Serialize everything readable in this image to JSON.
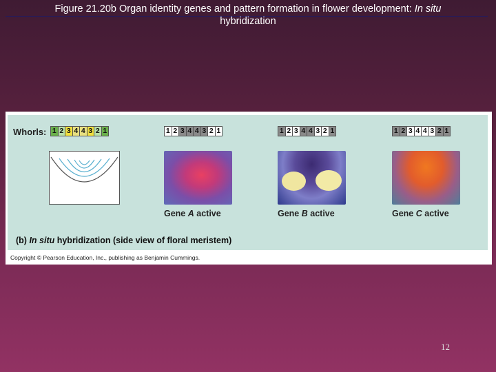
{
  "slide": {
    "title_main": "Figure 21.20b Organ identity genes and pattern formation in flower development: ",
    "title_italic": "In situ",
    "title_tail": "hybridization",
    "page_number": "12"
  },
  "figure": {
    "whorls_label": "Whorls:",
    "whorl_numbers": [
      "1",
      "2",
      "3",
      "4",
      "4",
      "3",
      "2",
      "1"
    ],
    "genes": [
      {
        "prefix": "Gene ",
        "letter": "A",
        "suffix": " active"
      },
      {
        "prefix": "Gene ",
        "letter": "B",
        "suffix": " active"
      },
      {
        "prefix": "Gene ",
        "letter": "C",
        "suffix": " active"
      }
    ],
    "caption_prefix": "(b) ",
    "caption_italic": "In situ",
    "caption_rest": " hybridization (side view of floral meristem)",
    "copyright": "Copyright © Pearson Education, Inc., publishing as Benjamin Cummings."
  }
}
